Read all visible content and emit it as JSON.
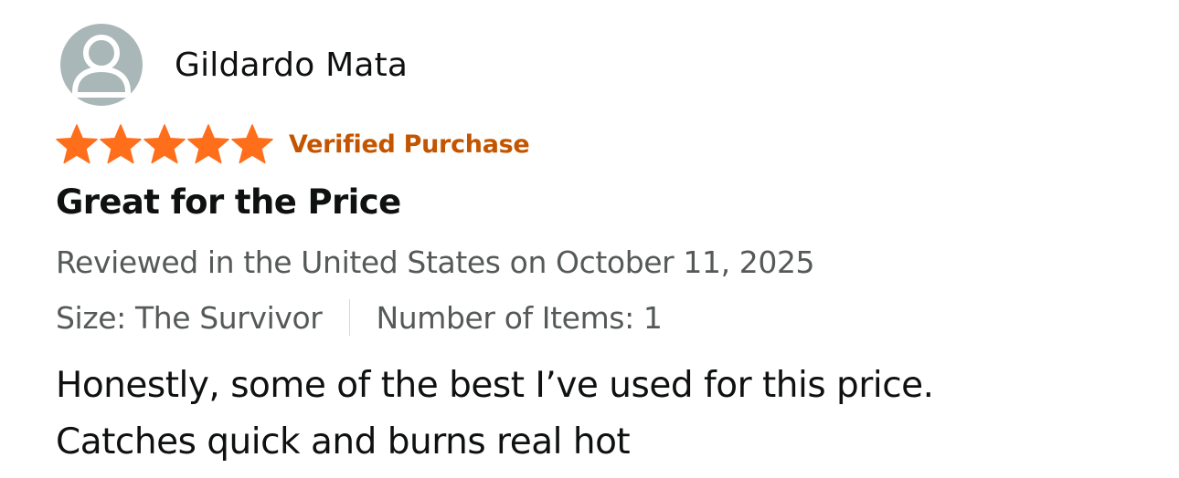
{
  "review": {
    "reviewer_name": "Gildardo Mata",
    "avatar_icon": "user-silhouette-icon",
    "rating": {
      "stars": 5,
      "max_stars": 5,
      "star_icon": "star-icon",
      "star_color": "#ff6e1a"
    },
    "verified_label": "Verified Purchase",
    "title": "Great for the Price",
    "date_text": "Reviewed in the United States on October 11, 2025",
    "variant": {
      "size": "Size: The Survivor",
      "items": "Number of Items: 1"
    },
    "body_lines": [
      "Honestly, some of the best I’ve used for this price.",
      "Catches quick and burns real hot"
    ]
  },
  "colors": {
    "verified": "#c45500",
    "avatar_bg": "#aab7b8",
    "secondary_text": "#565959",
    "primary_text": "#0f1111"
  }
}
